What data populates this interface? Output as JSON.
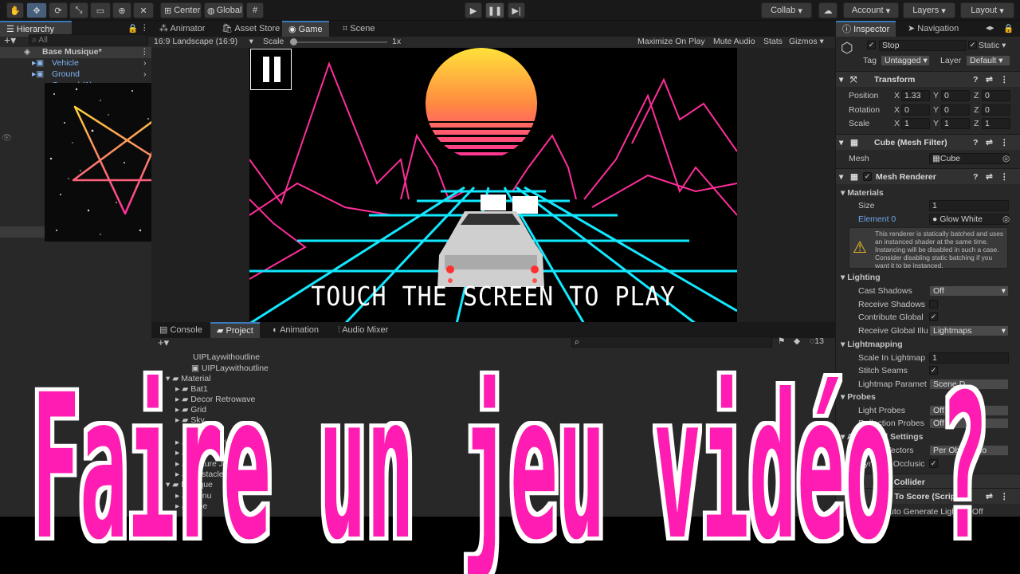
{
  "toolbar": {
    "center_label": "Center",
    "global_label": "Global",
    "collab_label": "Collab",
    "account_label": "Account",
    "layers_label": "Layers",
    "layout_label": "Layout"
  },
  "hierarchy": {
    "tab": "Hierarchy",
    "search_placeholder": "All",
    "scene_name": "Base Musique*",
    "items": [
      "Vehicle",
      "Ground",
      "Ground (1)"
    ]
  },
  "center_tabs": [
    "Animator",
    "Asset Store",
    "Game",
    "Scene"
  ],
  "game_bar": {
    "aspect": "16:9 Landscape (16:9)",
    "scale_label": "Scale",
    "scale_value": "1x",
    "maximize": "Maximize On Play",
    "mute": "Mute Audio",
    "stats": "Stats",
    "gizmos": "Gizmos"
  },
  "game_view": {
    "prompt": "TOUCH THE SCREEN TO PLAY",
    "sun_color": "#ff9d3a",
    "grid_color": "#12e8ff",
    "mountain_color": "#ff2e9a"
  },
  "bottom_tabs": [
    "Console",
    "Project",
    "Animation",
    "Audio Mixer"
  ],
  "project": {
    "count": "13",
    "items": [
      "UIPLaywithoutline",
      "UIPLaywithoutline",
      "Material",
      "Bat1",
      "Decor Retrowave",
      "Grid",
      "Sky",
      "Sonc Parier",
      "Voiture I",
      "Voiture J",
      "Obstacle",
      "Musique",
      "Menu",
      "Sine"
    ]
  },
  "inspector": {
    "tab": "Inspector",
    "tab2": "Navigation",
    "object_name": "Stop",
    "static_label": "Static",
    "tag_label": "Tag",
    "tag_value": "Untagged",
    "layer_label": "Layer",
    "layer_value": "Default",
    "transform": {
      "title": "Transform",
      "position_label": "Position",
      "position": [
        "1.33",
        "0",
        "0"
      ],
      "rotation_label": "Rotation",
      "rotation": [
        "0",
        "0",
        "0"
      ],
      "scale_label": "Scale",
      "scale": [
        "1",
        "1",
        "1"
      ]
    },
    "mesh_filter": {
      "title": "Cube (Mesh Filter)",
      "mesh_label": "Mesh",
      "mesh_value": "Cube"
    },
    "mesh_renderer": {
      "title": "Mesh Renderer",
      "materials_label": "Materials",
      "size_label": "Size",
      "size_value": "1",
      "element_label": "Element 0",
      "element_value": "Glow White",
      "warning": "This renderer is statically batched and uses an instanced shader at the same time. Instancing will be disabled in such a case. Consider disabling static batching if you want it to be instanced."
    },
    "lighting": {
      "title": "Lighting",
      "cast_shadows_label": "Cast Shadows",
      "cast_shadows_value": "Off",
      "receive_shadows_label": "Receive Shadows",
      "contribute_label": "Contribute Global",
      "receive_gi_label": "Receive Global Illu",
      "receive_gi_value": "Lightmaps"
    },
    "lightmapping": {
      "title": "Lightmapping",
      "scale_label": "Scale In Lightmap",
      "scale_value": "1",
      "stitch_label": "Stitch Seams",
      "params_label": "Lightmap Paramet",
      "params_value": "Scene D"
    },
    "probes": {
      "title": "Probes",
      "light_probes_label": "Light Probes",
      "light_probes_value": "Off",
      "reflection_label": "Reflection Probes",
      "reflection_value": "Off"
    },
    "additional": {
      "title": "Additional Settings",
      "motion_label": "Motion Vectors",
      "motion_value": "Per Object Mo",
      "dynamic_label": "Dynamic Occlusic"
    },
    "box_collider": "Box Collider",
    "add_score": "Add To Score (Script)",
    "footer": "Auto Generate Lighting Off"
  },
  "overlay": {
    "title": "Faire un jeu vidéo ?",
    "color": "#ff1ab3"
  }
}
